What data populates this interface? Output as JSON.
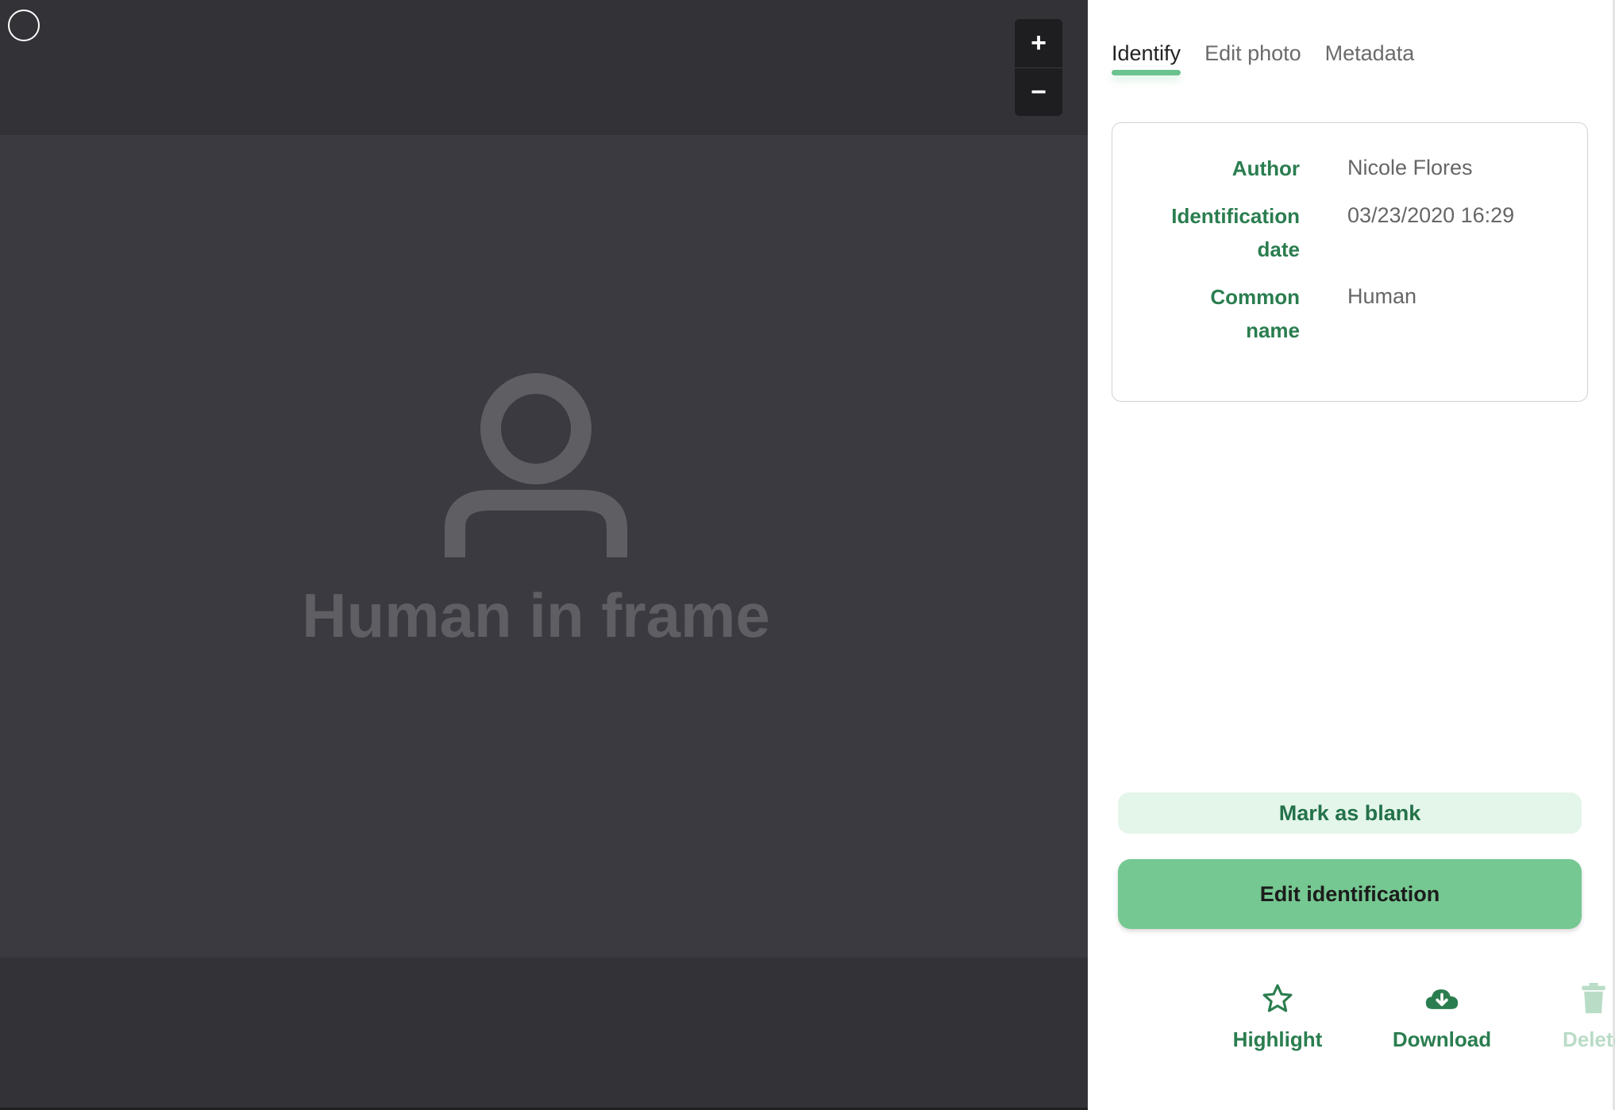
{
  "viewer": {
    "zoom_in_label": "+",
    "zoom_out_label": "−",
    "placeholder_text": "Human in frame"
  },
  "tabs": [
    {
      "label": "Identify",
      "active": true
    },
    {
      "label": "Edit photo",
      "active": false
    },
    {
      "label": "Metadata",
      "active": false
    }
  ],
  "identification": {
    "author_label": "Author",
    "author_value": "Nicole Flores",
    "date_label_line1": "Identification",
    "date_label_line2": "date",
    "date_value": "03/23/2020 16:29",
    "common_name_label_line1": "Common",
    "common_name_label_line2": "name",
    "common_name_value": "Human"
  },
  "buttons": {
    "mark_blank": "Mark as blank",
    "edit_identification": "Edit identification"
  },
  "actions": {
    "highlight": {
      "label": "Highlight",
      "icon": "star-icon",
      "enabled": true
    },
    "download": {
      "label": "Download",
      "icon": "cloud-download-icon",
      "enabled": true
    },
    "delete": {
      "label": "Delete",
      "icon": "trash-icon",
      "enabled": false
    }
  },
  "colors": {
    "accent_green": "#2a7d4f",
    "button_green": "#75c891",
    "viewer_background": "#333236"
  }
}
